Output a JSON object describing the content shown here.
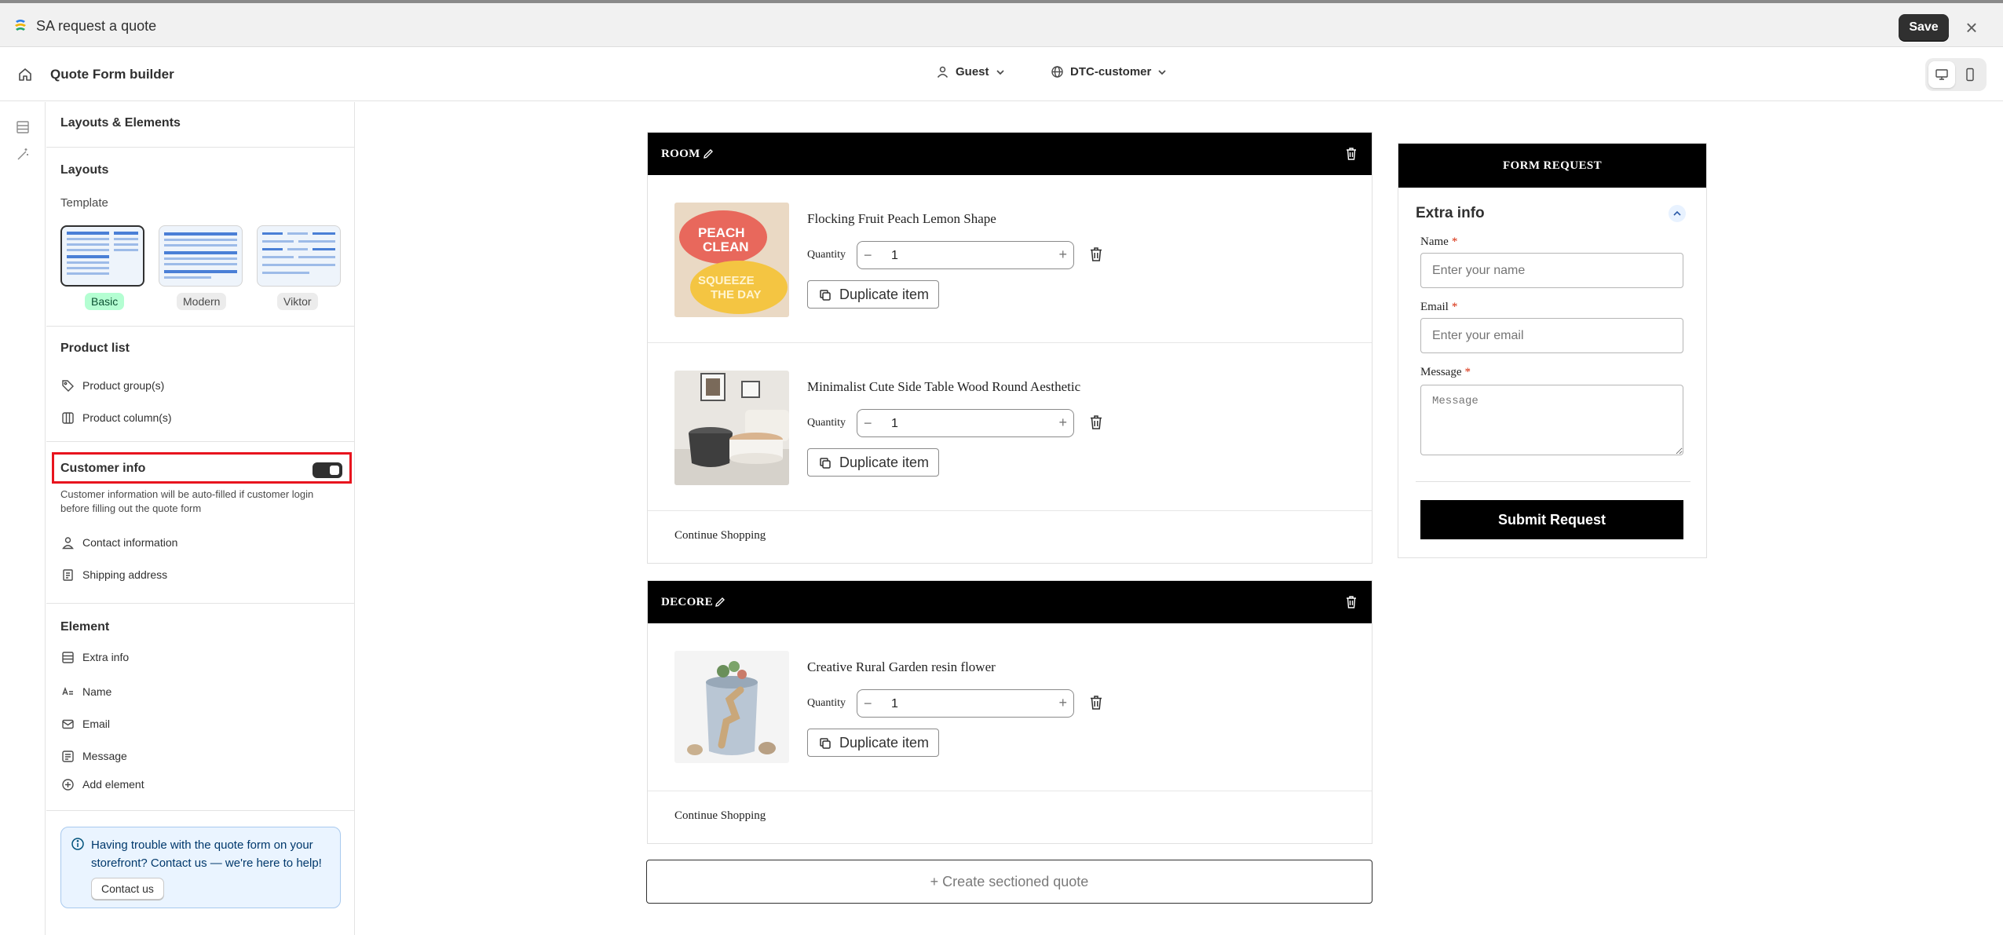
{
  "app": {
    "title": "SA request a quote",
    "save_label": "Save"
  },
  "header": {
    "title": "Quote Form builder",
    "customer_type": "Guest",
    "market": "DTC-customer"
  },
  "sidebar": {
    "heading": "Layouts & Elements",
    "layouts_title": "Layouts",
    "template_label": "Template",
    "templates": [
      {
        "label": "Basic",
        "selected": true
      },
      {
        "label": "Modern",
        "selected": false
      },
      {
        "label": "Viktor",
        "selected": false
      }
    ],
    "product_list_title": "Product list",
    "product_list_items": [
      {
        "label": "Product group(s)",
        "icon": "tag-icon"
      },
      {
        "label": "Product column(s)",
        "icon": "columns-icon"
      }
    ],
    "customer_info_title": "Customer info",
    "customer_info_enabled": true,
    "customer_info_desc": "Customer information will be auto-filled if customer login before filling out the quote form",
    "customer_items": [
      {
        "label": "Contact information",
        "icon": "person-icon"
      },
      {
        "label": "Shipping address",
        "icon": "address-icon"
      }
    ],
    "element_title": "Element",
    "element_items": [
      {
        "label": "Extra info",
        "icon": "table-icon"
      },
      {
        "label": "Name",
        "icon": "text-icon"
      },
      {
        "label": "Email",
        "icon": "email-icon"
      },
      {
        "label": "Message",
        "icon": "message-icon"
      },
      {
        "label": "Add element",
        "icon": "plus-circle-icon"
      }
    ],
    "help_text": "Having trouble with the quote form on your storefront? Contact us — we're here to help!",
    "contact_label": "Contact us"
  },
  "sections": [
    {
      "title": "ROOM",
      "products": [
        {
          "name": "Flocking Fruit Peach Lemon Shape",
          "qty_label": "Quantity",
          "qty": "1",
          "duplicate_label": "Duplicate item"
        },
        {
          "name": "Minimalist Cute Side Table Wood Round Aesthetic",
          "qty_label": "Quantity",
          "qty": "1",
          "duplicate_label": "Duplicate item"
        }
      ],
      "continue_label": "Continue Shopping"
    },
    {
      "title": "DECORE",
      "products": [
        {
          "name": "Creative Rural Garden resin flower",
          "qty_label": "Quantity",
          "qty": "1",
          "duplicate_label": "Duplicate item"
        }
      ],
      "continue_label": "Continue Shopping"
    }
  ],
  "create_section_label": "+ Create sectioned quote",
  "form": {
    "header": "FORM REQUEST",
    "extra_info_title": "Extra info",
    "name_label": "Name",
    "name_placeholder": "Enter your name",
    "email_label": "Email",
    "email_placeholder": "Enter your email",
    "message_label": "Message",
    "message_placeholder": "Message",
    "required_mark": "*",
    "submit_label": "Submit Request"
  },
  "colors": {
    "accent_dark": "#303030",
    "highlight_red": "#e8141e",
    "selected_tag_green": "#b4fed2",
    "info_bg": "#eaf4ff"
  }
}
